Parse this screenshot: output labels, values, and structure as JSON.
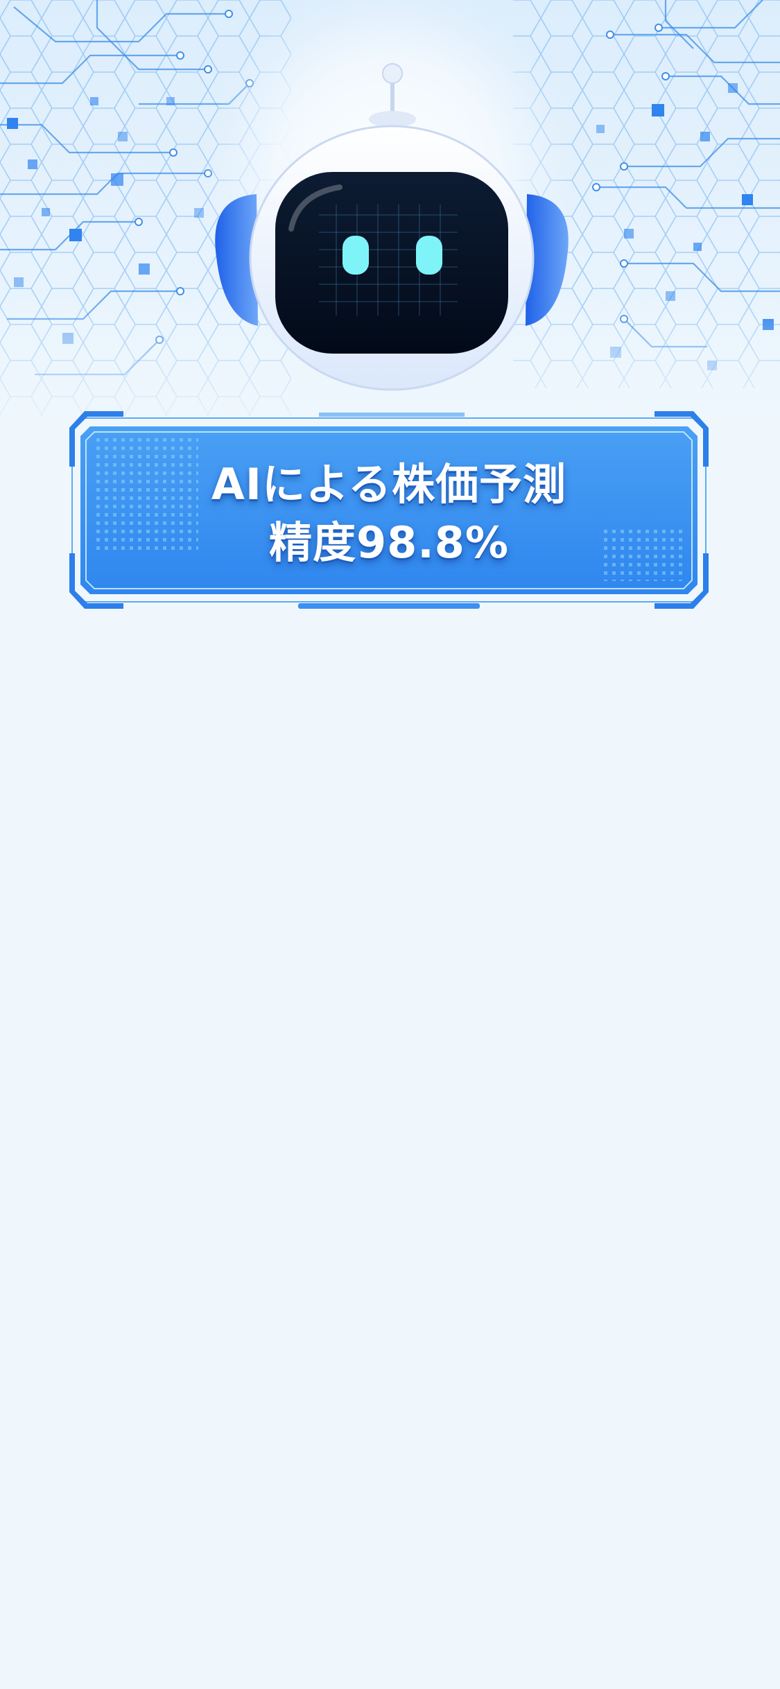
{
  "hero": {
    "illustration": "robot-mascot",
    "background": "circuit-board-pattern"
  },
  "banner": {
    "line1": "AIによる株価予測",
    "line2": "精度98.8%"
  },
  "colors": {
    "page_background": "#eff7fd",
    "banner_blue": "#3a8ff0",
    "banner_frame": "#2d7fea",
    "robot_eye": "#7ff4f8",
    "robot_screen": "#071426"
  }
}
